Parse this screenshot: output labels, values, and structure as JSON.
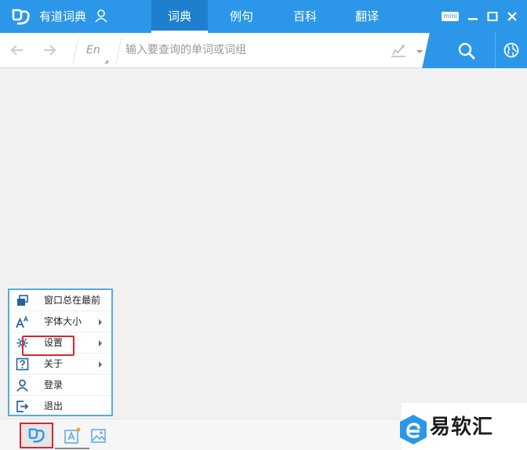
{
  "titlebar": {
    "app_title": "有道词典",
    "tabs": [
      {
        "label": "词典",
        "active": true
      },
      {
        "label": "例句",
        "active": false
      },
      {
        "label": "百科",
        "active": false
      },
      {
        "label": "翻译",
        "active": false
      }
    ],
    "mini_label": "mini",
    "accent_color": "#2c97e8",
    "icons": [
      "youdao-logo-icon",
      "user-icon",
      "minimize-icon",
      "maximize-icon",
      "close-icon"
    ]
  },
  "searchbar": {
    "language": "En",
    "placeholder": "输入要查询的单词或词组",
    "value": "",
    "icons": [
      "back-arrow-icon",
      "forward-arrow-icon",
      "handwriting-icon",
      "search-icon",
      "globe-icon"
    ]
  },
  "context_menu": {
    "items": [
      {
        "label": "窗口总在最前",
        "icon": "window-stack-icon",
        "has_submenu": false
      },
      {
        "label": "字体大小",
        "icon": "font-size-icon",
        "has_submenu": true
      },
      {
        "label": "设置",
        "icon": "settings-icon",
        "has_submenu": true,
        "highlighted": true
      },
      {
        "label": "关于",
        "icon": "help-icon",
        "has_submenu": true
      },
      {
        "label": "登录",
        "icon": "user-icon",
        "has_submenu": false
      },
      {
        "label": "退出",
        "icon": "exit-icon",
        "has_submenu": false
      }
    ],
    "highlight_color": "#d9262a"
  },
  "bottombar": {
    "icons": [
      "youdao-menu-icon",
      "word-card-icon",
      "image-translate-icon"
    ]
  },
  "watermark": {
    "text": "易软汇"
  }
}
